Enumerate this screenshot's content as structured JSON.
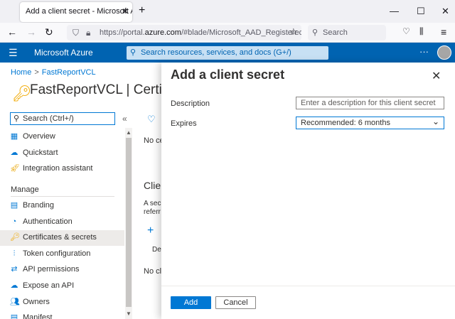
{
  "browser": {
    "tab_title": "Add a client secret - Microsoft Azure",
    "url_prefix": "https://portal.",
    "url_domain": "azure.com",
    "url_rest": "/#blade/Microsoft_AAD_RegisteredAp",
    "search_placeholder": "Search"
  },
  "azure": {
    "brand": "Microsoft Azure",
    "search_placeholder": "Search resources, services, and docs (G+/)",
    "more": "···"
  },
  "left_blade": {
    "breadcrumb": [
      "Home",
      "FastReportVCL"
    ],
    "title": "FastReportVCL | Certificates & secrets",
    "search_placeholder": "Search (Ctrl+/)",
    "items_top": [
      {
        "label": "Overview",
        "icon": "grid-icon",
        "color": "#0078d4"
      },
      {
        "label": "Quickstart",
        "icon": "cloud-icon",
        "color": "#0078d4"
      },
      {
        "label": "Integration assistant",
        "icon": "rocket-icon",
        "color": "#e8a400"
      }
    ],
    "section": "Manage",
    "items_manage": [
      {
        "label": "Branding",
        "icon": "branding-icon",
        "color": "#0078d4"
      },
      {
        "label": "Authentication",
        "icon": "auth-icon",
        "color": "#0078d4"
      },
      {
        "label": "Certificates & secrets",
        "icon": "key-icon",
        "color": "#f0a800",
        "selected": true
      },
      {
        "label": "Token configuration",
        "icon": "token-icon",
        "color": "#0078d4"
      },
      {
        "label": "API permissions",
        "icon": "permissions-icon",
        "color": "#0078d4"
      },
      {
        "label": "Expose an API",
        "icon": "cloud-api-icon",
        "color": "#0078d4"
      },
      {
        "label": "Owners",
        "icon": "owners-icon",
        "color": "#0078d4"
      },
      {
        "label": "Manifest",
        "icon": "manifest-icon",
        "color": "#0078d4"
      }
    ]
  },
  "middle": {
    "no_certs_fragment": "No ce",
    "client_heading_fragment": "Clie",
    "desc_line1": "A secr",
    "desc_line2": "referr",
    "desc_col_fragment": "Des",
    "no_secrets_fragment": "No cli"
  },
  "panel": {
    "title": "Add a client secret",
    "description_label": "Description",
    "description_placeholder": "Enter a description for this client secret",
    "expires_label": "Expires",
    "expires_value": "Recommended: 6 months",
    "add_label": "Add",
    "cancel_label": "Cancel"
  }
}
